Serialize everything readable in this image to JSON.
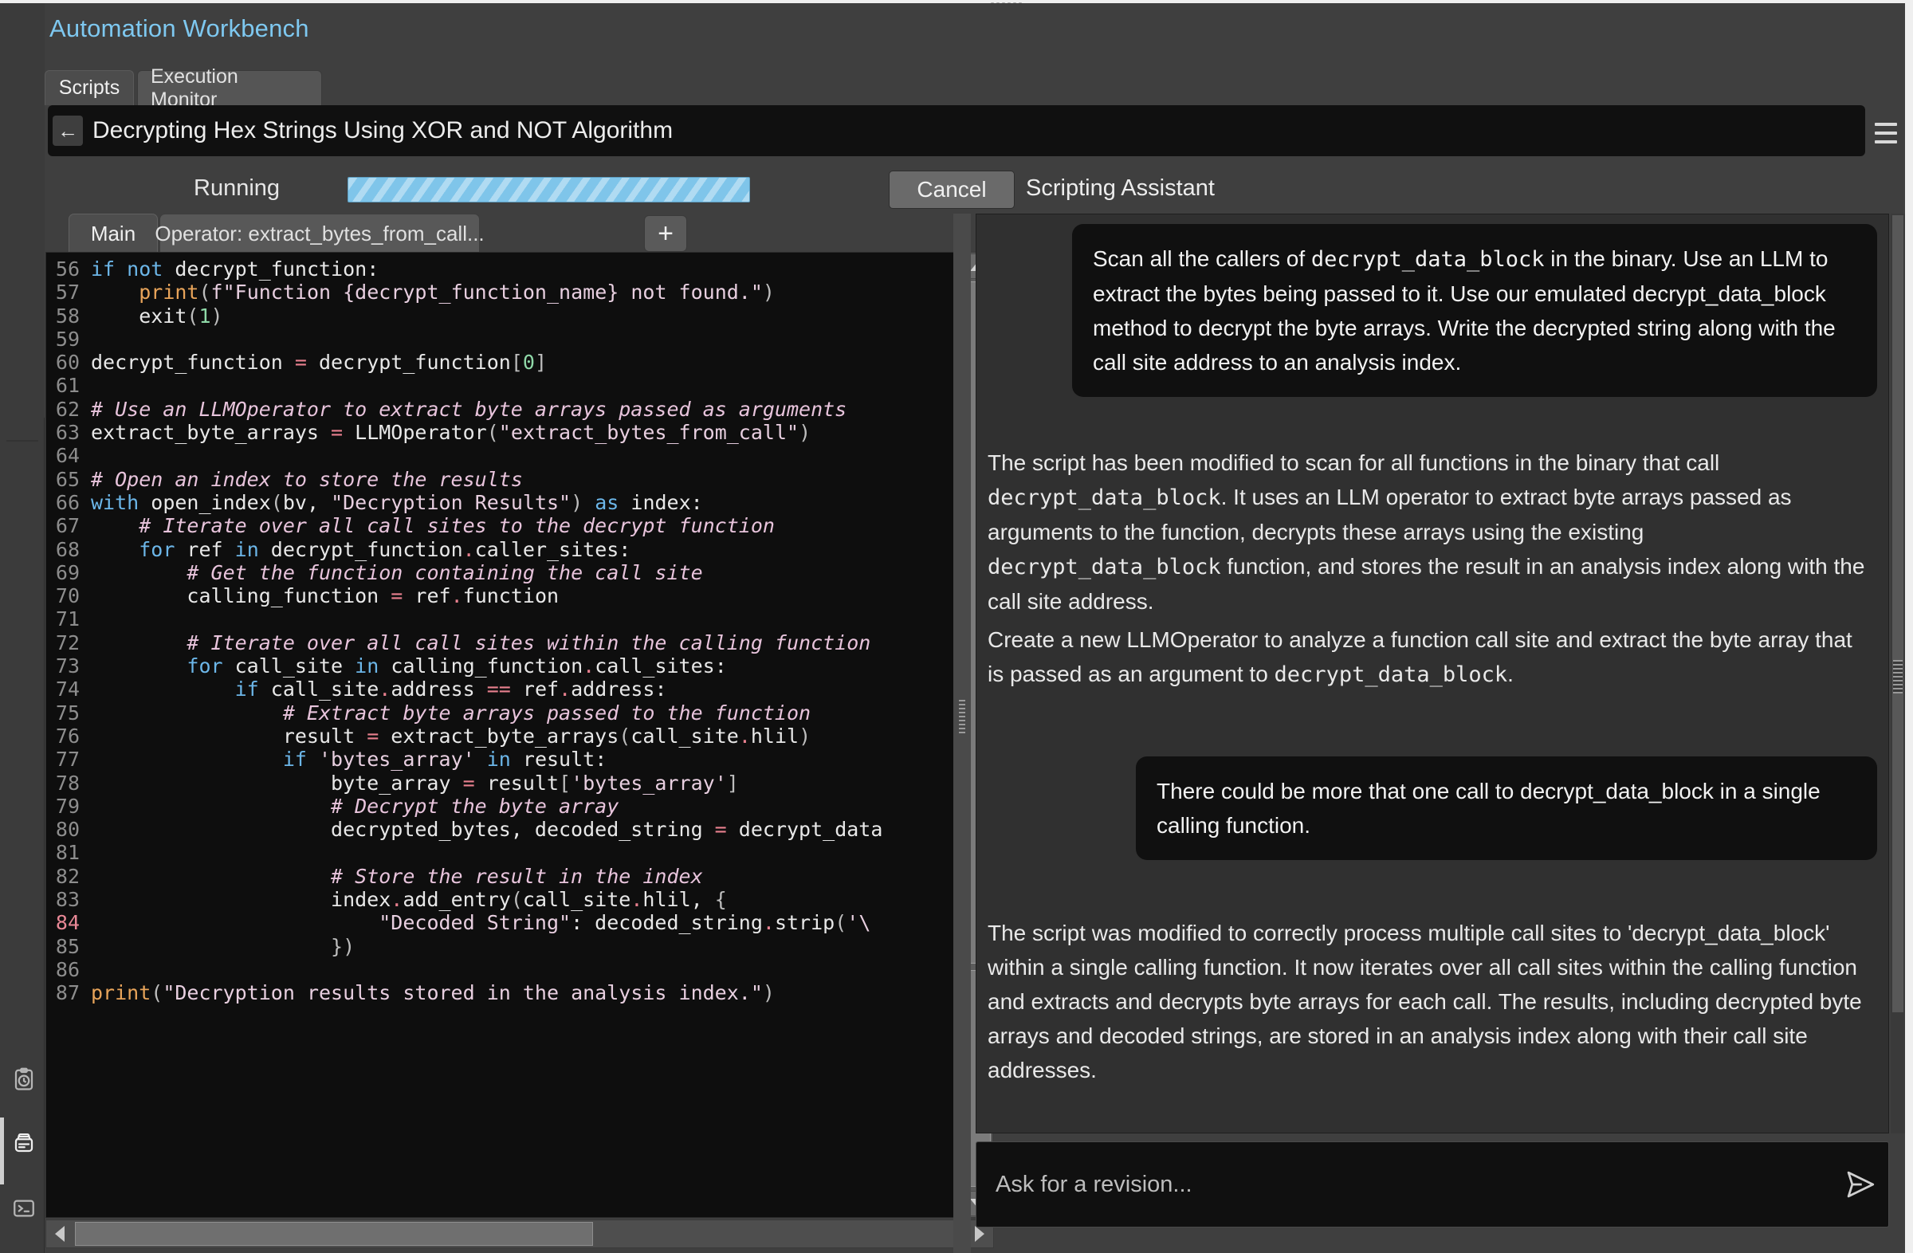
{
  "app": {
    "title": "Automation Workbench"
  },
  "top_tabs": [
    {
      "label": "Scripts",
      "active": true
    },
    {
      "label": "Execution Monitor",
      "active": false
    }
  ],
  "titlebar": {
    "back_icon": "arrow-left-icon",
    "document_title": "Decrypting Hex Strings Using XOR and NOT Algorithm",
    "menu_icon": "hamburger-menu-icon"
  },
  "status": {
    "running_label": "Running",
    "progress_percent": 100,
    "progress_color": "#7fc5ea",
    "cancel_label": "Cancel"
  },
  "assistant": {
    "panel_title": "Scripting Assistant",
    "input_placeholder": "Ask for a revision...",
    "input_value": "",
    "send_icon": "send-arrow-icon",
    "messages": [
      {
        "role": "user",
        "segments": [
          {
            "type": "text",
            "value": "Scan all the callers of "
          },
          {
            "type": "code",
            "value": "decrypt_data_block"
          },
          {
            "type": "text",
            "value": " in the binary. Use an LLM to extract the bytes being passed to it. Use our emulated decrypt_data_block method to decrypt the byte arrays. Write the decrypted string along with the call site address to an analysis index."
          }
        ]
      },
      {
        "role": "assistant",
        "segments": [
          {
            "type": "text",
            "value": "The script has been modified to scan for all functions in the binary that call "
          },
          {
            "type": "code",
            "value": "decrypt_data_block"
          },
          {
            "type": "text",
            "value": ". It uses an LLM operator to extract byte arrays passed as arguments to the function, decrypts these arrays using the existing "
          },
          {
            "type": "code",
            "value": "decrypt_data_block"
          },
          {
            "type": "text",
            "value": " function, and stores the result in an analysis index along with the call site address."
          }
        ]
      },
      {
        "role": "assistant",
        "segments": [
          {
            "type": "text",
            "value": "Create a new LLMOperator to analyze a function call site and extract the byte array that is passed as an argument to "
          },
          {
            "type": "code",
            "value": "decrypt_data_block"
          },
          {
            "type": "text",
            "value": "."
          }
        ]
      },
      {
        "role": "user",
        "segments": [
          {
            "type": "text",
            "value": "There could be more that one call to decrypt_data_block in a single calling function."
          }
        ]
      },
      {
        "role": "assistant",
        "segments": [
          {
            "type": "text",
            "value": "The script was modified to correctly process multiple call sites to 'decrypt_data_block' within a single calling function. It now iterates over all call sites within the calling function and extracts and decrypts byte arrays for each call. The results, including decrypted byte arrays and decoded strings, are stored in an analysis index along with their call site addresses."
          }
        ]
      }
    ]
  },
  "editor": {
    "tabs": [
      {
        "label": "Main",
        "active": true
      },
      {
        "label": "Operator: extract_bytes_from_call...",
        "active": false
      }
    ],
    "add_tab_label": "+",
    "error_line": 84,
    "lines": [
      {
        "n": 56,
        "tokens": [
          {
            "c": "kw",
            "t": "if"
          },
          {
            "c": "pln",
            "t": " "
          },
          {
            "c": "kw",
            "t": "not"
          },
          {
            "c": "pln",
            "t": " decrypt_function:"
          }
        ]
      },
      {
        "n": 57,
        "tokens": [
          {
            "c": "pln",
            "t": "    "
          },
          {
            "c": "fn",
            "t": "print"
          },
          {
            "c": "brk",
            "t": "("
          },
          {
            "c": "str",
            "t": "f\"Function {decrypt_function_name} not found.\""
          },
          {
            "c": "brk",
            "t": ")"
          }
        ]
      },
      {
        "n": 58,
        "tokens": [
          {
            "c": "pln",
            "t": "    exit"
          },
          {
            "c": "brk",
            "t": "("
          },
          {
            "c": "num",
            "t": "1"
          },
          {
            "c": "brk",
            "t": ")"
          }
        ]
      },
      {
        "n": 59,
        "tokens": []
      },
      {
        "n": 60,
        "tokens": [
          {
            "c": "pln",
            "t": "decrypt_function "
          },
          {
            "c": "op",
            "t": "="
          },
          {
            "c": "pln",
            "t": " decrypt_function"
          },
          {
            "c": "brk",
            "t": "["
          },
          {
            "c": "num",
            "t": "0"
          },
          {
            "c": "brk",
            "t": "]"
          }
        ]
      },
      {
        "n": 61,
        "tokens": []
      },
      {
        "n": 62,
        "tokens": [
          {
            "c": "cmt",
            "t": "# Use an LLMOperator to extract byte arrays passed as arguments"
          }
        ]
      },
      {
        "n": 63,
        "tokens": [
          {
            "c": "pln",
            "t": "extract_byte_arrays "
          },
          {
            "c": "op",
            "t": "="
          },
          {
            "c": "pln",
            "t": " LLMOperator"
          },
          {
            "c": "brk",
            "t": "("
          },
          {
            "c": "str",
            "t": "\"extract_bytes_from_call\""
          },
          {
            "c": "brk",
            "t": ")"
          }
        ]
      },
      {
        "n": 64,
        "tokens": []
      },
      {
        "n": 65,
        "tokens": [
          {
            "c": "cmt",
            "t": "# Open an index to store the results"
          }
        ]
      },
      {
        "n": 66,
        "tokens": [
          {
            "c": "kw",
            "t": "with"
          },
          {
            "c": "pln",
            "t": " open_index"
          },
          {
            "c": "brk",
            "t": "("
          },
          {
            "c": "pln",
            "t": "bv, "
          },
          {
            "c": "str",
            "t": "\"Decryption Results\""
          },
          {
            "c": "brk",
            "t": ")"
          },
          {
            "c": "pln",
            "t": " "
          },
          {
            "c": "kw",
            "t": "as"
          },
          {
            "c": "pln",
            "t": " index:"
          }
        ]
      },
      {
        "n": 67,
        "tokens": [
          {
            "c": "pln",
            "t": "    "
          },
          {
            "c": "cmt",
            "t": "# Iterate over all call sites to the decrypt function"
          }
        ]
      },
      {
        "n": 68,
        "tokens": [
          {
            "c": "pln",
            "t": "    "
          },
          {
            "c": "kw",
            "t": "for"
          },
          {
            "c": "pln",
            "t": " ref "
          },
          {
            "c": "kw",
            "t": "in"
          },
          {
            "c": "pln",
            "t": " decrypt_function"
          },
          {
            "c": "op",
            "t": "."
          },
          {
            "c": "pln",
            "t": "caller_sites:"
          }
        ]
      },
      {
        "n": 69,
        "tokens": [
          {
            "c": "pln",
            "t": "        "
          },
          {
            "c": "cmt",
            "t": "# Get the function containing the call site"
          }
        ]
      },
      {
        "n": 70,
        "tokens": [
          {
            "c": "pln",
            "t": "        calling_function "
          },
          {
            "c": "op",
            "t": "="
          },
          {
            "c": "pln",
            "t": " ref"
          },
          {
            "c": "op",
            "t": "."
          },
          {
            "c": "pln",
            "t": "function"
          }
        ]
      },
      {
        "n": 71,
        "tokens": []
      },
      {
        "n": 72,
        "tokens": [
          {
            "c": "pln",
            "t": "        "
          },
          {
            "c": "cmt",
            "t": "# Iterate over all call sites within the calling function"
          }
        ]
      },
      {
        "n": 73,
        "tokens": [
          {
            "c": "pln",
            "t": "        "
          },
          {
            "c": "kw",
            "t": "for"
          },
          {
            "c": "pln",
            "t": " call_site "
          },
          {
            "c": "kw",
            "t": "in"
          },
          {
            "c": "pln",
            "t": " calling_function"
          },
          {
            "c": "op",
            "t": "."
          },
          {
            "c": "pln",
            "t": "call_sites:"
          }
        ]
      },
      {
        "n": 74,
        "tokens": [
          {
            "c": "pln",
            "t": "            "
          },
          {
            "c": "kw",
            "t": "if"
          },
          {
            "c": "pln",
            "t": " call_site"
          },
          {
            "c": "op",
            "t": "."
          },
          {
            "c": "pln",
            "t": "address "
          },
          {
            "c": "op",
            "t": "=="
          },
          {
            "c": "pln",
            "t": " ref"
          },
          {
            "c": "op",
            "t": "."
          },
          {
            "c": "pln",
            "t": "address:"
          }
        ]
      },
      {
        "n": 75,
        "tokens": [
          {
            "c": "pln",
            "t": "                "
          },
          {
            "c": "cmt",
            "t": "# Extract byte arrays passed to the function"
          }
        ]
      },
      {
        "n": 76,
        "tokens": [
          {
            "c": "pln",
            "t": "                result "
          },
          {
            "c": "op",
            "t": "="
          },
          {
            "c": "pln",
            "t": " extract_byte_arrays"
          },
          {
            "c": "brk",
            "t": "("
          },
          {
            "c": "pln",
            "t": "call_site"
          },
          {
            "c": "op",
            "t": "."
          },
          {
            "c": "pln",
            "t": "hlil"
          },
          {
            "c": "brk",
            "t": ")"
          }
        ]
      },
      {
        "n": 77,
        "tokens": [
          {
            "c": "pln",
            "t": "                "
          },
          {
            "c": "kw",
            "t": "if"
          },
          {
            "c": "pln",
            "t": " "
          },
          {
            "c": "str",
            "t": "'bytes_array'"
          },
          {
            "c": "pln",
            "t": " "
          },
          {
            "c": "kw",
            "t": "in"
          },
          {
            "c": "pln",
            "t": " result:"
          }
        ]
      },
      {
        "n": 78,
        "tokens": [
          {
            "c": "pln",
            "t": "                    byte_array "
          },
          {
            "c": "op",
            "t": "="
          },
          {
            "c": "pln",
            "t": " result"
          },
          {
            "c": "brk",
            "t": "["
          },
          {
            "c": "str",
            "t": "'bytes_array'"
          },
          {
            "c": "brk",
            "t": "]"
          }
        ]
      },
      {
        "n": 79,
        "tokens": [
          {
            "c": "pln",
            "t": "                    "
          },
          {
            "c": "cmt",
            "t": "# Decrypt the byte array"
          }
        ]
      },
      {
        "n": 80,
        "tokens": [
          {
            "c": "pln",
            "t": "                    decrypted_bytes, decoded_string "
          },
          {
            "c": "op",
            "t": "="
          },
          {
            "c": "pln",
            "t": " decrypt_data"
          }
        ]
      },
      {
        "n": 81,
        "tokens": []
      },
      {
        "n": 82,
        "tokens": [
          {
            "c": "pln",
            "t": "                    "
          },
          {
            "c": "cmt",
            "t": "# Store the result in the index"
          }
        ]
      },
      {
        "n": 83,
        "tokens": [
          {
            "c": "pln",
            "t": "                    index"
          },
          {
            "c": "op",
            "t": "."
          },
          {
            "c": "pln",
            "t": "add_entry"
          },
          {
            "c": "brk",
            "t": "("
          },
          {
            "c": "pln",
            "t": "call_site"
          },
          {
            "c": "op",
            "t": "."
          },
          {
            "c": "pln",
            "t": "hlil, "
          },
          {
            "c": "brk",
            "t": "{"
          }
        ]
      },
      {
        "n": 84,
        "tokens": [
          {
            "c": "pln",
            "t": "                        "
          },
          {
            "c": "str",
            "t": "\"Decoded String\""
          },
          {
            "c": "pln",
            "t": ": decoded_string"
          },
          {
            "c": "op",
            "t": "."
          },
          {
            "c": "pln",
            "t": "strip"
          },
          {
            "c": "brk",
            "t": "("
          },
          {
            "c": "str",
            "t": "'\\"
          }
        ]
      },
      {
        "n": 85,
        "tokens": [
          {
            "c": "pln",
            "t": "                    "
          },
          {
            "c": "brk",
            "t": "})"
          }
        ]
      },
      {
        "n": 86,
        "tokens": []
      },
      {
        "n": 87,
        "tokens": [
          {
            "c": "fn",
            "t": "print"
          },
          {
            "c": "brk",
            "t": "("
          },
          {
            "c": "str",
            "t": "\"Decryption results stored in the analysis index.\""
          },
          {
            "c": "brk",
            "t": ")"
          }
        ]
      }
    ]
  },
  "sidebar": {
    "icons": [
      {
        "name": "clipboard-clock-icon",
        "active": false
      },
      {
        "name": "database-stack-icon",
        "active": true
      },
      {
        "name": "terminal-icon",
        "active": false
      }
    ]
  },
  "colors": {
    "accent": "#7ec8f0",
    "progress": "#7fc5ea",
    "error_line": "#e98896",
    "window_bg": "#3f3f3f",
    "code_bg": "#0e0e0e"
  }
}
